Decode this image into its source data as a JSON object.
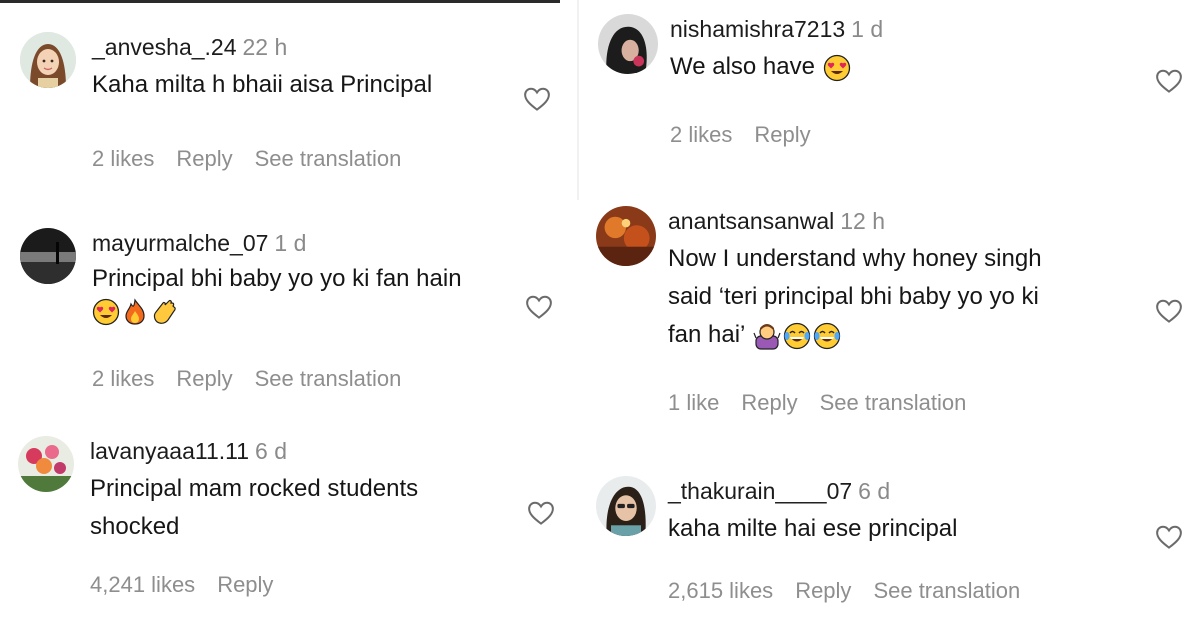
{
  "colors": {
    "text": "#161616",
    "muted": "#8e8e8e",
    "background": "#ffffff"
  },
  "comments": [
    {
      "username": "_anvesha_.24",
      "time": "22 h",
      "lines": [
        "Kaha milta h bhaii aisa Principal"
      ],
      "emojis": [],
      "likes": "2 likes",
      "reply": "Reply",
      "translation": "See translation",
      "avatar_icon": "avatar-girl-illustration-icon"
    },
    {
      "username": "mayurmalche_07",
      "time": "1 d",
      "lines": [
        "Principal bhi baby yo yo ki fan hain"
      ],
      "emojis": [
        "heart-eyes-emoji",
        "fire-emoji",
        "clapping-hands-emoji"
      ],
      "likes": "2 likes",
      "reply": "Reply",
      "translation": "See translation",
      "avatar_icon": "avatar-landscape-icon"
    },
    {
      "username": "lavanyaaa11.11",
      "time": "6 d",
      "lines": [
        "Principal mam rocked students",
        "shocked"
      ],
      "emojis": [],
      "likes": "4,241 likes",
      "reply": "Reply",
      "translation": "",
      "avatar_icon": "avatar-flowers-icon"
    },
    {
      "username": "nishamishra7213",
      "time": "1 d",
      "lines": [
        "We also have"
      ],
      "emojis": [
        "heart-eyes-emoji"
      ],
      "likes": "2 likes",
      "reply": "Reply",
      "translation": "",
      "avatar_icon": "avatar-portrait-dark-icon"
    },
    {
      "username": "anantsansanwal",
      "time": "12 h",
      "lines": [
        "Now I understand why honey singh",
        "said ‘teri principal bhi baby yo yo ki",
        "fan hai’"
      ],
      "emojis": [
        "woman-shrugging-emoji",
        "tears-of-joy-emoji",
        "tears-of-joy-emoji"
      ],
      "likes": "1 like",
      "reply": "Reply",
      "translation": "See translation",
      "avatar_icon": "avatar-warm-photo-icon"
    },
    {
      "username": "_thakurain____07",
      "time": "6 d",
      "lines": [
        "kaha milte hai ese principal"
      ],
      "emojis": [],
      "likes": "2,615 likes",
      "reply": "Reply",
      "translation": "See translation",
      "avatar_icon": "avatar-selfie-icon"
    }
  ]
}
